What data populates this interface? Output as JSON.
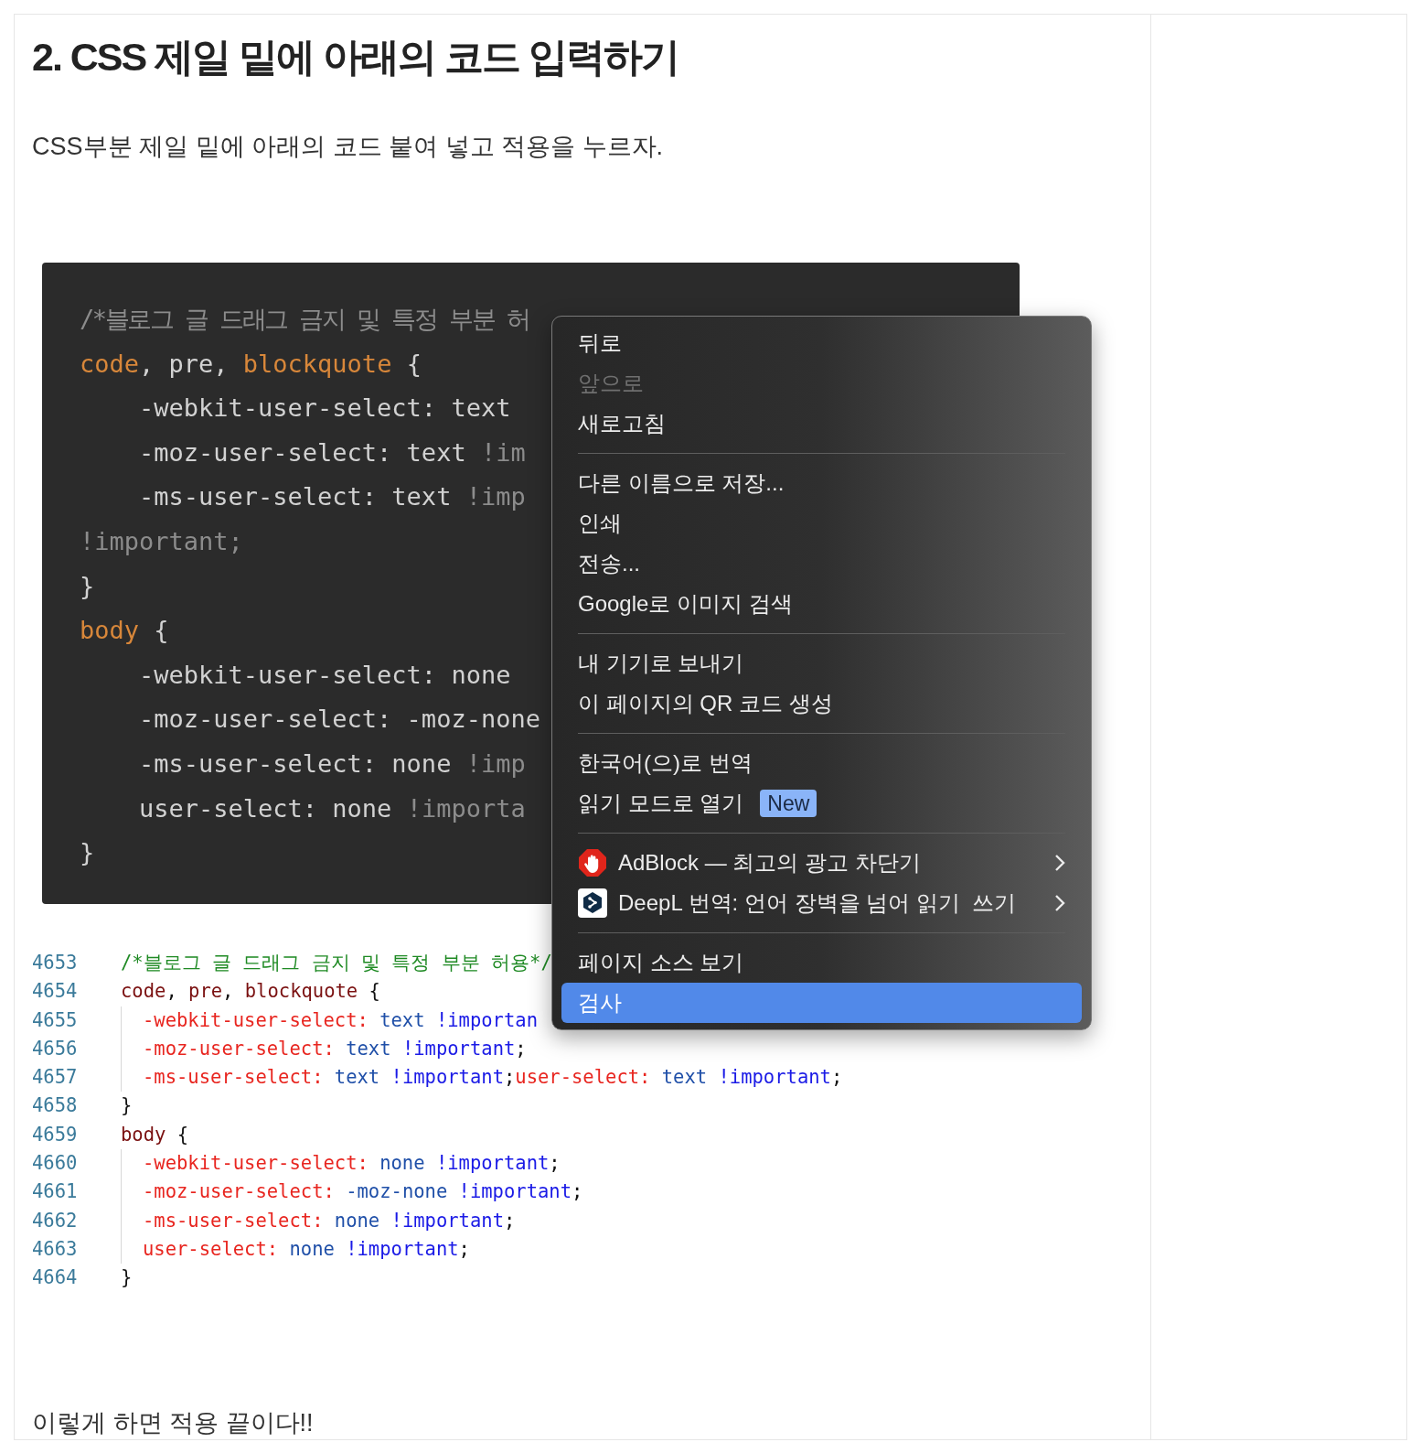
{
  "heading": "2. CSS 제일 밑에 아래의 코드 입력하기",
  "intro": "CSS부분 제일 밑에 아래의 코드 붙여 넣고 적용을 누르자.",
  "code_block": {
    "lines": [
      [
        {
          "text": "/*블로그 글 드래그 금지 및 특정 부분 허",
          "kind": "comment"
        }
      ],
      [
        {
          "text": "code",
          "kind": "selector"
        },
        {
          "text": ", pre, ",
          "kind": "plain"
        },
        {
          "text": "blockquote",
          "kind": "selector"
        },
        {
          "text": " {",
          "kind": "plain"
        }
      ],
      [
        {
          "text": "    -webkit-user-select: text",
          "kind": "plain"
        }
      ],
      [
        {
          "text": "    -moz-user-select: text ",
          "kind": "plain"
        },
        {
          "text": "!im",
          "kind": "muted"
        }
      ],
      [
        {
          "text": "    -ms-user-select: text ",
          "kind": "plain"
        },
        {
          "text": "!imp",
          "kind": "muted"
        }
      ],
      [
        {
          "text": "!important;",
          "kind": "muted"
        }
      ],
      [
        {
          "text": "}",
          "kind": "plain"
        }
      ],
      [
        {
          "text": "body",
          "kind": "selector"
        },
        {
          "text": " {",
          "kind": "plain"
        }
      ],
      [
        {
          "text": "    -webkit-user-select: none",
          "kind": "plain"
        }
      ],
      [
        {
          "text": "    -moz-user-select: -moz-none",
          "kind": "plain"
        }
      ],
      [
        {
          "text": "    -ms-user-select: none ",
          "kind": "plain"
        },
        {
          "text": "!imp",
          "kind": "muted"
        }
      ],
      [
        {
          "text": "    user-select: none ",
          "kind": "plain"
        },
        {
          "text": "!importa",
          "kind": "muted"
        }
      ],
      [
        {
          "text": "}",
          "kind": "plain"
        }
      ]
    ]
  },
  "listing": [
    {
      "number": "4653",
      "indented": false,
      "parts": [
        {
          "text": "/*블로그 글 드래그 금지 및 특정 부분 허용*/",
          "kind": "comment"
        }
      ]
    },
    {
      "number": "4654",
      "indented": false,
      "parts": [
        {
          "text": "code",
          "kind": "selector"
        },
        {
          "text": ", ",
          "kind": "punct"
        },
        {
          "text": "pre",
          "kind": "selector"
        },
        {
          "text": ", ",
          "kind": "punct"
        },
        {
          "text": "blockquote",
          "kind": "selector"
        },
        {
          "text": " {",
          "kind": "punct"
        }
      ]
    },
    {
      "number": "4655",
      "indented": true,
      "parts": [
        {
          "text": "-webkit-user-select:",
          "kind": "property"
        },
        {
          "text": " text ",
          "kind": "value"
        },
        {
          "text": "!importan",
          "kind": "important"
        }
      ]
    },
    {
      "number": "4656",
      "indented": true,
      "parts": [
        {
          "text": "-moz-user-select:",
          "kind": "property"
        },
        {
          "text": " text ",
          "kind": "value"
        },
        {
          "text": "!important",
          "kind": "important"
        },
        {
          "text": ";",
          "kind": "punct"
        }
      ]
    },
    {
      "number": "4657",
      "indented": true,
      "parts": [
        {
          "text": "-ms-user-select:",
          "kind": "property"
        },
        {
          "text": " text ",
          "kind": "value"
        },
        {
          "text": "!important",
          "kind": "important"
        },
        {
          "text": ";",
          "kind": "punct"
        },
        {
          "text": "user-select:",
          "kind": "property"
        },
        {
          "text": " text ",
          "kind": "value"
        },
        {
          "text": "!important",
          "kind": "important"
        },
        {
          "text": ";",
          "kind": "punct"
        }
      ]
    },
    {
      "number": "4658",
      "indented": false,
      "parts": [
        {
          "text": "}",
          "kind": "punct"
        }
      ]
    },
    {
      "number": "4659",
      "indented": false,
      "parts": [
        {
          "text": "body",
          "kind": "selector"
        },
        {
          "text": " {",
          "kind": "punct"
        }
      ]
    },
    {
      "number": "4660",
      "indented": true,
      "parts": [
        {
          "text": "-webkit-user-select:",
          "kind": "property"
        },
        {
          "text": " none ",
          "kind": "value"
        },
        {
          "text": "!important",
          "kind": "important"
        },
        {
          "text": ";",
          "kind": "punct"
        }
      ]
    },
    {
      "number": "4661",
      "indented": true,
      "parts": [
        {
          "text": "-moz-user-select:",
          "kind": "property"
        },
        {
          "text": " -moz-none ",
          "kind": "value"
        },
        {
          "text": "!important",
          "kind": "important"
        },
        {
          "text": ";",
          "kind": "punct"
        }
      ]
    },
    {
      "number": "4662",
      "indented": true,
      "parts": [
        {
          "text": "-ms-user-select:",
          "kind": "property"
        },
        {
          "text": " none ",
          "kind": "value"
        },
        {
          "text": "!important",
          "kind": "important"
        },
        {
          "text": ";",
          "kind": "punct"
        }
      ]
    },
    {
      "number": "4663",
      "indented": true,
      "parts": [
        {
          "text": "user-select:",
          "kind": "property"
        },
        {
          "text": " none ",
          "kind": "value"
        },
        {
          "text": "!important",
          "kind": "important"
        },
        {
          "text": ";",
          "kind": "punct"
        }
      ]
    },
    {
      "number": "4664",
      "indented": false,
      "parts": [
        {
          "text": "}",
          "kind": "punct"
        }
      ]
    }
  ],
  "outro": "이렇게 하면 적용 끝이다!!",
  "context_menu": {
    "groups": [
      [
        {
          "label": "뒤로",
          "disabled": false,
          "selected": false
        },
        {
          "label": "앞으로",
          "disabled": true,
          "selected": false
        },
        {
          "label": "새로고침",
          "disabled": false,
          "selected": false
        }
      ],
      [
        {
          "label": "다른 이름으로 저장...",
          "disabled": false,
          "selected": false
        },
        {
          "label": "인쇄",
          "disabled": false,
          "selected": false
        },
        {
          "label": "전송...",
          "disabled": false,
          "selected": false
        },
        {
          "label": "Google로 이미지 검색",
          "disabled": false,
          "selected": false
        }
      ],
      [
        {
          "label": "내 기기로 보내기",
          "disabled": false,
          "selected": false
        },
        {
          "label": "이 페이지의 QR 코드 생성",
          "disabled": false,
          "selected": false
        }
      ],
      [
        {
          "label": "한국어(으)로 번역",
          "disabled": false,
          "selected": false
        },
        {
          "label": "읽기 모드로 열기",
          "disabled": false,
          "selected": false,
          "badge": "New"
        }
      ],
      [
        {
          "label": "AdBlock — 최고의 광고 차단기",
          "disabled": false,
          "selected": false,
          "kind": "extension",
          "submenu": true
        },
        {
          "label": "DeepL 번역: 언어 장벽을 넘어 읽기  쓰기",
          "disabled": false,
          "selected": false,
          "kind": "extension",
          "submenu": true
        }
      ],
      [
        {
          "label": "페이지 소스 보기",
          "disabled": false,
          "selected": false
        },
        {
          "label": "검사",
          "disabled": false,
          "selected": true
        }
      ]
    ]
  }
}
